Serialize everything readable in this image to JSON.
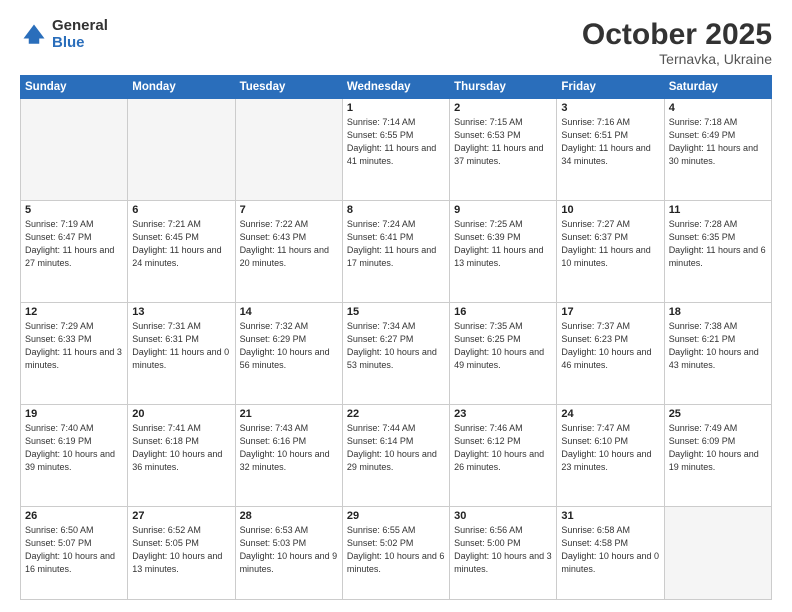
{
  "header": {
    "logo_general": "General",
    "logo_blue": "Blue",
    "month": "October 2025",
    "location": "Ternavka, Ukraine"
  },
  "weekdays": [
    "Sunday",
    "Monday",
    "Tuesday",
    "Wednesday",
    "Thursday",
    "Friday",
    "Saturday"
  ],
  "weeks": [
    [
      {
        "day": "",
        "empty": true
      },
      {
        "day": "",
        "empty": true
      },
      {
        "day": "",
        "empty": true
      },
      {
        "day": "1",
        "sunrise": "7:14 AM",
        "sunset": "6:55 PM",
        "daylight": "11 hours and 41 minutes."
      },
      {
        "day": "2",
        "sunrise": "7:15 AM",
        "sunset": "6:53 PM",
        "daylight": "11 hours and 37 minutes."
      },
      {
        "day": "3",
        "sunrise": "7:16 AM",
        "sunset": "6:51 PM",
        "daylight": "11 hours and 34 minutes."
      },
      {
        "day": "4",
        "sunrise": "7:18 AM",
        "sunset": "6:49 PM",
        "daylight": "11 hours and 30 minutes."
      }
    ],
    [
      {
        "day": "5",
        "sunrise": "7:19 AM",
        "sunset": "6:47 PM",
        "daylight": "11 hours and 27 minutes."
      },
      {
        "day": "6",
        "sunrise": "7:21 AM",
        "sunset": "6:45 PM",
        "daylight": "11 hours and 24 minutes."
      },
      {
        "day": "7",
        "sunrise": "7:22 AM",
        "sunset": "6:43 PM",
        "daylight": "11 hours and 20 minutes."
      },
      {
        "day": "8",
        "sunrise": "7:24 AM",
        "sunset": "6:41 PM",
        "daylight": "11 hours and 17 minutes."
      },
      {
        "day": "9",
        "sunrise": "7:25 AM",
        "sunset": "6:39 PM",
        "daylight": "11 hours and 13 minutes."
      },
      {
        "day": "10",
        "sunrise": "7:27 AM",
        "sunset": "6:37 PM",
        "daylight": "11 hours and 10 minutes."
      },
      {
        "day": "11",
        "sunrise": "7:28 AM",
        "sunset": "6:35 PM",
        "daylight": "11 hours and 6 minutes."
      }
    ],
    [
      {
        "day": "12",
        "sunrise": "7:29 AM",
        "sunset": "6:33 PM",
        "daylight": "11 hours and 3 minutes."
      },
      {
        "day": "13",
        "sunrise": "7:31 AM",
        "sunset": "6:31 PM",
        "daylight": "11 hours and 0 minutes."
      },
      {
        "day": "14",
        "sunrise": "7:32 AM",
        "sunset": "6:29 PM",
        "daylight": "10 hours and 56 minutes."
      },
      {
        "day": "15",
        "sunrise": "7:34 AM",
        "sunset": "6:27 PM",
        "daylight": "10 hours and 53 minutes."
      },
      {
        "day": "16",
        "sunrise": "7:35 AM",
        "sunset": "6:25 PM",
        "daylight": "10 hours and 49 minutes."
      },
      {
        "day": "17",
        "sunrise": "7:37 AM",
        "sunset": "6:23 PM",
        "daylight": "10 hours and 46 minutes."
      },
      {
        "day": "18",
        "sunrise": "7:38 AM",
        "sunset": "6:21 PM",
        "daylight": "10 hours and 43 minutes."
      }
    ],
    [
      {
        "day": "19",
        "sunrise": "7:40 AM",
        "sunset": "6:19 PM",
        "daylight": "10 hours and 39 minutes."
      },
      {
        "day": "20",
        "sunrise": "7:41 AM",
        "sunset": "6:18 PM",
        "daylight": "10 hours and 36 minutes."
      },
      {
        "day": "21",
        "sunrise": "7:43 AM",
        "sunset": "6:16 PM",
        "daylight": "10 hours and 32 minutes."
      },
      {
        "day": "22",
        "sunrise": "7:44 AM",
        "sunset": "6:14 PM",
        "daylight": "10 hours and 29 minutes."
      },
      {
        "day": "23",
        "sunrise": "7:46 AM",
        "sunset": "6:12 PM",
        "daylight": "10 hours and 26 minutes."
      },
      {
        "day": "24",
        "sunrise": "7:47 AM",
        "sunset": "6:10 PM",
        "daylight": "10 hours and 23 minutes."
      },
      {
        "day": "25",
        "sunrise": "7:49 AM",
        "sunset": "6:09 PM",
        "daylight": "10 hours and 19 minutes."
      }
    ],
    [
      {
        "day": "26",
        "sunrise": "6:50 AM",
        "sunset": "5:07 PM",
        "daylight": "10 hours and 16 minutes."
      },
      {
        "day": "27",
        "sunrise": "6:52 AM",
        "sunset": "5:05 PM",
        "daylight": "10 hours and 13 minutes."
      },
      {
        "day": "28",
        "sunrise": "6:53 AM",
        "sunset": "5:03 PM",
        "daylight": "10 hours and 9 minutes."
      },
      {
        "day": "29",
        "sunrise": "6:55 AM",
        "sunset": "5:02 PM",
        "daylight": "10 hours and 6 minutes."
      },
      {
        "day": "30",
        "sunrise": "6:56 AM",
        "sunset": "5:00 PM",
        "daylight": "10 hours and 3 minutes."
      },
      {
        "day": "31",
        "sunrise": "6:58 AM",
        "sunset": "4:58 PM",
        "daylight": "10 hours and 0 minutes."
      },
      {
        "day": "",
        "empty": true
      }
    ]
  ]
}
